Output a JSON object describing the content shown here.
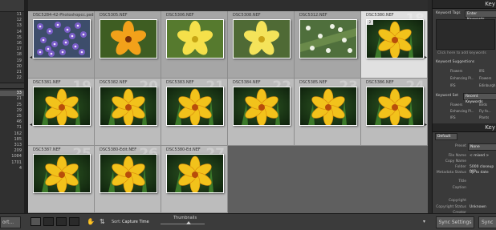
{
  "left_panel": {
    "header": "",
    "numbers": [
      "11",
      "12",
      "13",
      "14",
      "15",
      "16",
      "17",
      "18",
      "19",
      "20",
      "21",
      "22"
    ],
    "numbers2": [
      "33",
      "21",
      "25",
      "29",
      "25",
      "46",
      "71",
      "162",
      "185",
      "313",
      "209",
      "1084",
      "1701",
      "4"
    ]
  },
  "grid": {
    "cells": [
      {
        "name": "DSC5284-42-Photoshopcc.psd",
        "index": "",
        "kind": "purple",
        "badge": ""
      },
      {
        "name": "DSC5305.NEF",
        "index": "",
        "kind": "orange1",
        "badge": ""
      },
      {
        "name": "DSC5306.NEF",
        "index": "",
        "kind": "yellow1",
        "badge": ""
      },
      {
        "name": "DSC5308.NEF",
        "index": "",
        "kind": "yellow2",
        "badge": ""
      },
      {
        "name": "DSC5312.NEF",
        "index": "",
        "kind": "white",
        "badge": ""
      },
      {
        "name": "DSC5380.NEF",
        "index": "18",
        "kind": "lily",
        "badge": "2"
      },
      {
        "name": "DSC5381.NEF",
        "index": "19",
        "kind": "lily",
        "badge": ""
      },
      {
        "name": "DSC5382.NEF",
        "index": "20",
        "kind": "lily",
        "badge": ""
      },
      {
        "name": "DSC5383.NEF",
        "index": "21",
        "kind": "lily",
        "badge": ""
      },
      {
        "name": "DSC5384.NEF",
        "index": "22",
        "kind": "lily",
        "badge": ""
      },
      {
        "name": "DSC5385.NEF",
        "index": "23",
        "kind": "lily",
        "badge": ""
      },
      {
        "name": "DSC5386.NEF",
        "index": "24",
        "kind": "lily",
        "badge": ""
      },
      {
        "name": "DSC5387.NEF",
        "index": "25",
        "kind": "lily",
        "badge": ""
      },
      {
        "name": "DSC5380-Edit.NEF",
        "index": "26",
        "kind": "lily",
        "badge": ""
      },
      {
        "name": "DSC5380-Ed.NEF",
        "index": "27",
        "kind": "lily",
        "badge": ""
      }
    ]
  },
  "toolbar": {
    "import_label": "ort...",
    "sort_label": "Sort:",
    "sort_value": "Capture Time",
    "thumbs_label": "Thumbnails",
    "sync_settings": "Sync Settings",
    "sync_metadata": "Sync"
  },
  "right_panel": {
    "keywording_title": "Key",
    "keyword_tags_label": "Keyword Tags",
    "enter_keywords": "Enter Keywords",
    "add_keywords_hint": "Click here to add keywords",
    "suggestions_title": "Keyword Suggestions",
    "suggestions": [
      "Flowers",
      "IRS",
      "Enhancing Pl...",
      "Flowers",
      "IRS",
      "Edinburgh"
    ],
    "keyword_set_label": "Keyword Set",
    "keyword_set_value": "Recent Keywords",
    "set_items": [
      "Flowers",
      "Birds",
      "Enhancing Pl...",
      "Fly fo...",
      "IRS",
      "Plants"
    ],
    "metadata_title": "Key",
    "default_label": "Default",
    "preset_label": "Preset",
    "preset_value": "None",
    "rows": [
      {
        "label": "File Name",
        "value": "< mixed >"
      },
      {
        "label": "Copy Name",
        "value": ""
      },
      {
        "label": "Folder",
        "value": "5000 closeup exp"
      },
      {
        "label": "Metadata Status",
        "value": "Up to date"
      },
      {
        "label": "Title",
        "value": ""
      },
      {
        "label": "Caption",
        "value": ""
      },
      {
        "label": "Copyright",
        "value": ""
      },
      {
        "label": "Copyright Status",
        "value": "Unknown"
      },
      {
        "label": "Creator",
        "value": ""
      }
    ]
  }
}
